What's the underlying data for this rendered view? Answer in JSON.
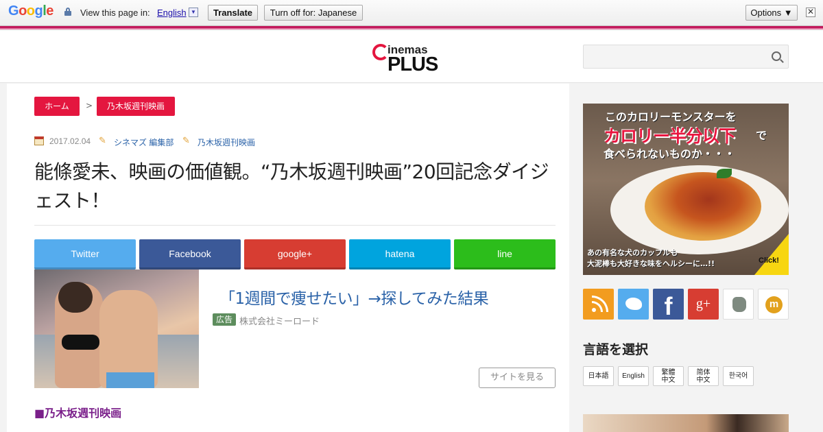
{
  "translate_bar": {
    "logo_letters": [
      {
        "char": "G",
        "color": "#4285f4"
      },
      {
        "char": "o",
        "color": "#ea4335"
      },
      {
        "char": "o",
        "color": "#fbbc05"
      },
      {
        "char": "g",
        "color": "#4285f4"
      },
      {
        "char": "l",
        "color": "#34a853"
      },
      {
        "char": "e",
        "color": "#ea4335"
      }
    ],
    "view_label": "View this page in:",
    "language": "English",
    "language_arrow": "▼",
    "translate_label": "Translate",
    "turn_off_label": "Turn off for: Japanese",
    "options_label": "Options ▼",
    "close_label": "✕"
  },
  "header": {
    "logo_top": "inemas",
    "logo_bottom": "PLUS",
    "search_placeholder": ""
  },
  "breadcrumb": {
    "home": "ホーム",
    "separator": ">",
    "category": "乃木坂週刊映画"
  },
  "article": {
    "date": "2017.02.04",
    "author": "シネマズ 編集部",
    "category": "乃木坂週刊映画",
    "title": "能條愛未、映画の価値観。“乃木坂週刊映画”20回記念ダイジェスト！",
    "section_heading": "■乃木坂週刊映画"
  },
  "share": {
    "twitter": "Twitter",
    "facebook": "Facebook",
    "google": "google+",
    "hatena": "hatena",
    "line": "line"
  },
  "ad": {
    "headline": "「1週間で痩せたい」→探してみた結果",
    "badge": "広告",
    "advertiser": "株式会社ミーロード",
    "cta": "サイトを見る"
  },
  "sidebar": {
    "banner": {
      "line1": "このカロリーモンスターを",
      "line2": "カロリー半分以下",
      "line2_suffix": "で",
      "line3": "食べられないものか・・・",
      "line4a": "あの有名な犬のカップルも",
      "line4b": "大泥棒も大好きな味をヘルシーに…!!",
      "click": "Click!"
    },
    "social_icons": [
      "rss-icon",
      "twitter-icon",
      "facebook-icon",
      "google-plus-icon",
      "evernote-icon",
      "mixi-icon"
    ],
    "fb_letter": "f",
    "gp_letter": "g+",
    "m_letter": "m",
    "language_title": "言語を選択",
    "languages": {
      "ja": "日本語",
      "en": "English",
      "tw_1": "繁體",
      "tw_2": "中文",
      "cn_1": "简体",
      "cn_2": "中文",
      "ko": "한국어"
    }
  },
  "colors": {
    "brand_red": "#e4163f",
    "accent_pink": "#c2185b",
    "link_blue": "#2a62a8"
  }
}
